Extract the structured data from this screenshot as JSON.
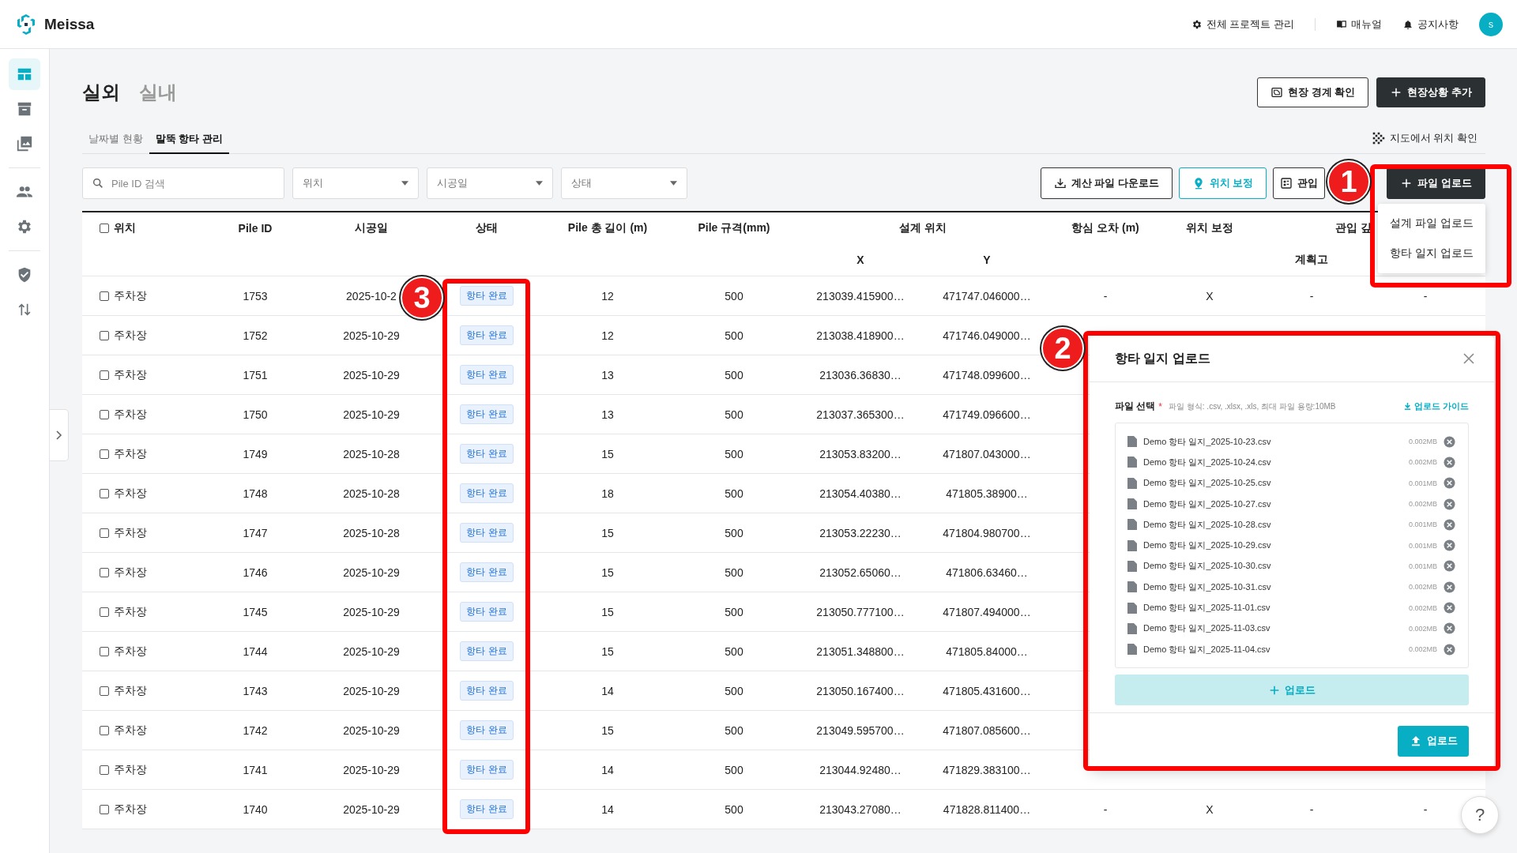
{
  "app": {
    "name": "Meissa"
  },
  "topnav": [
    {
      "kind": "gear",
      "label": "전체 프로젝트 관리"
    },
    {
      "kind": "book",
      "label": "매뉴얼"
    },
    {
      "kind": "bell",
      "label": "공지사항"
    }
  ],
  "avatar": {
    "initial": "s"
  },
  "sidebar": {
    "groups": [
      [
        {
          "kind": "dashboard",
          "selected": true
        },
        {
          "kind": "archive",
          "selected": false
        },
        {
          "kind": "images",
          "selected": false
        }
      ],
      [
        {
          "kind": "people",
          "selected": false
        },
        {
          "kind": "gear",
          "selected": false
        }
      ],
      [
        {
          "kind": "shield",
          "selected": false
        },
        {
          "kind": "transfer",
          "selected": false
        }
      ]
    ]
  },
  "modes": [
    {
      "label": "실외",
      "selected": true
    },
    {
      "label": "실내",
      "selected": false
    }
  ],
  "actions": [
    {
      "kind": "frame",
      "label": "현장 경계 확인"
    },
    {
      "kind": "add",
      "label": "현장상황 추가"
    }
  ],
  "tabs": [
    {
      "label": "날짜별 현황",
      "selected": false
    },
    {
      "label": "말뚝 항타 관리",
      "selected": true
    }
  ],
  "map_link": {
    "label": "지도에서 위치 확인"
  },
  "filters": {
    "search": {
      "placeholder": "Pile ID 검색"
    },
    "selects": [
      {
        "placeholder": "위치"
      },
      {
        "placeholder": "시공일"
      },
      {
        "placeholder": "상태"
      }
    ]
  },
  "toolbar": [
    {
      "kind": "download",
      "label": "계산 파일 다운로드"
    },
    {
      "kind": "pin",
      "label": "위치 보정"
    },
    {
      "kind": "grid",
      "label": "관입"
    },
    {
      "kind": "add",
      "label": "파일 업로드"
    }
  ],
  "upload_menu": [
    {
      "label": "설계 파일 업로드"
    },
    {
      "label": "항타 일지 업로드"
    }
  ],
  "table": {
    "all_checked": false,
    "columns": [
      {
        "label": "위치"
      },
      {
        "label": "Pile ID"
      },
      {
        "label": "시공일"
      },
      {
        "label": "상태"
      },
      {
        "label": "Pile 총 길이 (m)"
      },
      {
        "label": "Pile 규격(mm)"
      },
      {
        "label": "설계 위치",
        "sub": "X"
      },
      {
        "sub": "Y"
      },
      {
        "label": "항심 오차 (m)"
      },
      {
        "label": "위치 보정"
      },
      {
        "label": "관입 깊",
        "sub": "계획고"
      },
      {}
    ],
    "rows": [
      {
        "checked": false,
        "cells": [
          "주차장",
          "1753",
          "2025-10-2",
          "항타 완료",
          "12",
          "500",
          "213039.415900…",
          "471747.046000…",
          "-",
          "X",
          "-",
          "-"
        ]
      },
      {
        "checked": false,
        "cells": [
          "주차장",
          "1752",
          "2025-10-29",
          "항타 완료",
          "12",
          "500",
          "213038.418900…",
          "471746.049000…"
        ]
      },
      {
        "checked": false,
        "cells": [
          "주차장",
          "1751",
          "2025-10-29",
          "항타 완료",
          "13",
          "500",
          "213036.36830…",
          "471748.099600…"
        ]
      },
      {
        "checked": false,
        "cells": [
          "주차장",
          "1750",
          "2025-10-29",
          "항타 완료",
          "13",
          "500",
          "213037.365300…",
          "471749.096600…"
        ]
      },
      {
        "checked": false,
        "cells": [
          "주차장",
          "1749",
          "2025-10-28",
          "항타 완료",
          "15",
          "500",
          "213053.83200…",
          "471807.043000…"
        ]
      },
      {
        "checked": false,
        "cells": [
          "주차장",
          "1748",
          "2025-10-28",
          "항타 완료",
          "18",
          "500",
          "213054.40380…",
          "471805.38900…"
        ]
      },
      {
        "checked": false,
        "cells": [
          "주차장",
          "1747",
          "2025-10-28",
          "항타 완료",
          "15",
          "500",
          "213053.22230…",
          "471804.980700…"
        ]
      },
      {
        "checked": false,
        "cells": [
          "주차장",
          "1746",
          "2025-10-29",
          "항타 완료",
          "15",
          "500",
          "213052.65060…",
          "471806.63460…"
        ]
      },
      {
        "checked": false,
        "cells": [
          "주차장",
          "1745",
          "2025-10-29",
          "항타 완료",
          "15",
          "500",
          "213050.777100…",
          "471807.494000…"
        ]
      },
      {
        "checked": false,
        "cells": [
          "주차장",
          "1744",
          "2025-10-29",
          "항타 완료",
          "15",
          "500",
          "213051.348800…",
          "471805.84000…"
        ]
      },
      {
        "checked": false,
        "cells": [
          "주차장",
          "1743",
          "2025-10-29",
          "항타 완료",
          "14",
          "500",
          "213050.167400…",
          "471805.431600…"
        ]
      },
      {
        "checked": false,
        "cells": [
          "주차장",
          "1742",
          "2025-10-29",
          "항타 완료",
          "15",
          "500",
          "213049.595700…",
          "471807.085600…"
        ]
      },
      {
        "checked": false,
        "cells": [
          "주차장",
          "1741",
          "2025-10-29",
          "항타 완료",
          "14",
          "500",
          "213044.92480…",
          "471829.383100…"
        ]
      },
      {
        "checked": false,
        "cells": [
          "주차장",
          "1740",
          "2025-10-29",
          "항타 완료",
          "14",
          "500",
          "213043.27080…",
          "471828.811400…",
          "-",
          "X",
          "-",
          "-"
        ]
      }
    ]
  },
  "modal": {
    "title": "항타 일지 업로드",
    "field_label": "파일 선택",
    "required_mark": "*",
    "hint": "파일 형식: .csv, .xlsx, .xls, 최대 파일 용량:10MB",
    "guide_link": "업로드 가이드",
    "files": [
      {
        "name": "Demo 항타 일지_2025-10-23.csv",
        "size": "0.002MB"
      },
      {
        "name": "Demo 항타 일지_2025-10-24.csv",
        "size": "0.002MB"
      },
      {
        "name": "Demo 항타 일지_2025-10-25.csv",
        "size": "0.001MB"
      },
      {
        "name": "Demo 항타 일지_2025-10-27.csv",
        "size": "0.002MB"
      },
      {
        "name": "Demo 항타 일지_2025-10-28.csv",
        "size": "0.001MB"
      },
      {
        "name": "Demo 항타 일지_2025-10-29.csv",
        "size": "0.001MB"
      },
      {
        "name": "Demo 항타 일지_2025-10-30.csv",
        "size": "0.001MB"
      },
      {
        "name": "Demo 항타 일지_2025-10-31.csv",
        "size": "0.002MB"
      },
      {
        "name": "Demo 항타 일지_2025-11-01.csv",
        "size": "0.002MB"
      },
      {
        "name": "Demo 항타 일지_2025-11-03.csv",
        "size": "0.002MB"
      },
      {
        "name": "Demo 항타 일지_2025-11-04.csv",
        "size": "0.002MB"
      }
    ],
    "add_button": "업로드",
    "submit_button": "업로드"
  },
  "annotations": [
    {
      "label": "1"
    },
    {
      "label": "2"
    },
    {
      "label": "3"
    }
  ],
  "help": {
    "label": "?"
  }
}
